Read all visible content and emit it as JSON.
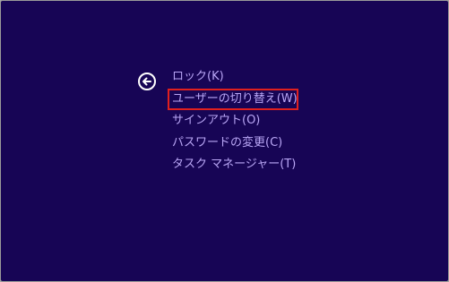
{
  "colors": {
    "background": "#170555",
    "menu_text": "#b9a6f5",
    "focus_outline": "#e0201e",
    "back_icon": "#ffffff"
  },
  "back_button": {
    "icon": "arrow-left-circle-icon"
  },
  "menu": {
    "items": [
      {
        "label": "ロック(K)",
        "selected": false
      },
      {
        "label": "ユーザーの切り替え(W)",
        "selected": true
      },
      {
        "label": "サインアウト(O)",
        "selected": false
      },
      {
        "label": "パスワードの変更(C)",
        "selected": false
      },
      {
        "label": "タスク マネージャー(T)",
        "selected": false
      }
    ]
  }
}
